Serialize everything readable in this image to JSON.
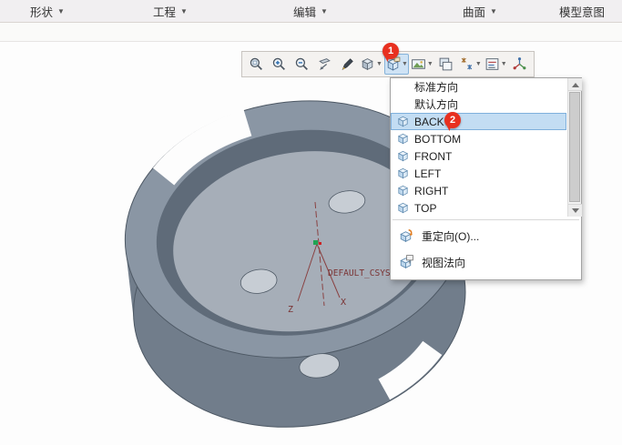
{
  "ribbon": {
    "tabs": [
      {
        "label": "形状"
      },
      {
        "label": "工程"
      },
      {
        "label": "编辑"
      },
      {
        "label": "曲面"
      },
      {
        "label": "模型意图"
      }
    ]
  },
  "toolbar": {
    "icons": [
      "zoom-region-icon",
      "zoom-in-icon",
      "zoom-out-icon",
      "refit-icon",
      "repaint-icon",
      "display-style-icon",
      "saved-orientations-icon",
      "image-capture-icon",
      "view-manager-icon",
      "datum-display-icon",
      "annotation-display-icon",
      "spin-center-icon"
    ],
    "active_button": "saved-orientations"
  },
  "callouts": {
    "step1": "1",
    "step2": "2"
  },
  "menu": {
    "items": [
      {
        "label": "标准方向",
        "icon": ""
      },
      {
        "label": "默认方向",
        "icon": ""
      },
      {
        "label": "BACK",
        "icon": "cube-icon",
        "selected": true
      },
      {
        "label": "BOTTOM",
        "icon": "cube-icon"
      },
      {
        "label": "FRONT",
        "icon": "cube-icon"
      },
      {
        "label": "LEFT",
        "icon": "cube-icon"
      },
      {
        "label": "RIGHT",
        "icon": "cube-icon"
      },
      {
        "label": "TOP",
        "icon": "cube-icon"
      }
    ],
    "footer": [
      {
        "label": "重定向(O)...",
        "icon": "reorient-icon"
      },
      {
        "label": "视图法向",
        "icon": "view-normal-icon"
      }
    ]
  },
  "canvas": {
    "csys_label": "DEFAULT_CSYS",
    "axis_z": "Z",
    "axis_x": "X"
  },
  "colors": {
    "callout_red": "#e8301f",
    "selection_blue": "#c3ddf3",
    "part_gray": "#8a96a4",
    "annotation_red": "#7a3333"
  }
}
